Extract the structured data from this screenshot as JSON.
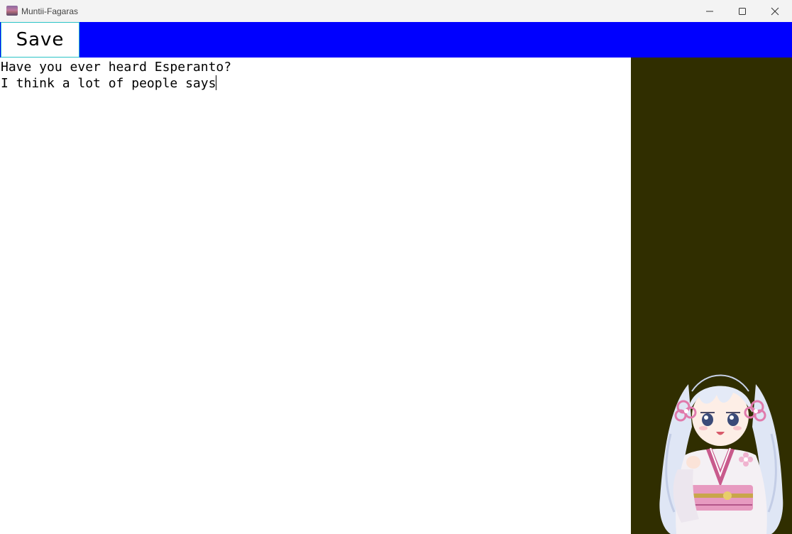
{
  "window": {
    "title": "Muntii-Fagaras",
    "app_icon": "landscape-app-icon",
    "controls": [
      "minimize-icon",
      "maximize-icon",
      "close-icon"
    ]
  },
  "toolbar": {
    "save_label": "Save",
    "background_color": "#0000ff"
  },
  "editor": {
    "lines": [
      "Have you ever heard Esperanto?",
      "I think a lot of people says"
    ]
  },
  "side_panel": {
    "background_color": "#302e00",
    "image": "anime-girl-kimono-character"
  }
}
